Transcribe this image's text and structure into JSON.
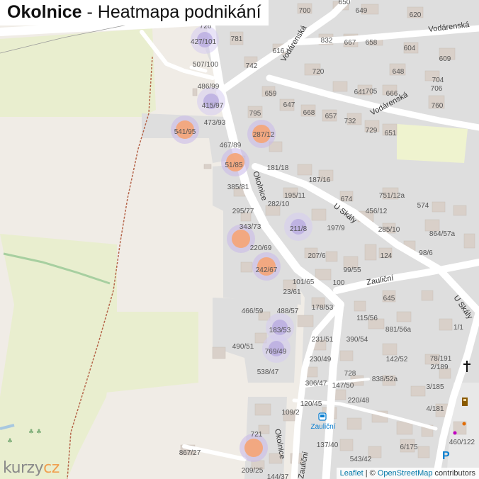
{
  "title": {
    "bold": "Okolnice",
    "rest": " - Heatmapa podnikání"
  },
  "logo": {
    "left": "kurzy",
    "right": "cz"
  },
  "attribution": {
    "leaflet": "Leaflet",
    "separator": " | © ",
    "osm": "OpenStreetMap",
    "suffix": " contributors"
  },
  "streets": [
    "Okolnice",
    "Vodárenská",
    "Vodárenská",
    "Vodárenská",
    "U Skály",
    "U Skály",
    "Zauliční",
    "Zauliční",
    "Okolnice"
  ],
  "bus_stop": "Zauliční",
  "address_labels": [
    "700",
    "650",
    "649",
    "620",
    "726",
    "781",
    "832",
    "667",
    "658",
    "604",
    "609",
    "427/101",
    "616",
    "742",
    "720",
    "648",
    "704",
    "706",
    "507/100",
    "705",
    "641",
    "666",
    "760",
    "486/99",
    "659",
    "647",
    "668",
    "657",
    "732",
    "729",
    "651",
    "415/97",
    "795",
    "473/93",
    "541/95",
    "287/12",
    "467/89",
    "51/85",
    "181/18",
    "187/16",
    "385/81",
    "195/11",
    "674",
    "751/12a",
    "282/10",
    "456/12",
    "574",
    "295/77",
    "343/73",
    "211/8",
    "197/9",
    "285/10",
    "864/57a",
    "220/69",
    "207/6",
    "124",
    "98/6",
    "242/67",
    "99/55",
    "101/65",
    "100",
    "23/61",
    "645",
    "466/59",
    "488/57",
    "178/53",
    "115/56",
    "1/1",
    "881/56a",
    "183/53",
    "231/51",
    "390/54",
    "490/51",
    "769/49",
    "230/49",
    "142/52",
    "78/191",
    "2/189",
    "538/47",
    "728",
    "838/52a",
    "306/47",
    "147/50",
    "3/185",
    "220/48",
    "109/2",
    "120/45",
    "4/181",
    "721",
    "137/40",
    "6/175",
    "460/122",
    "867/27",
    "543/42",
    "209/25",
    "144/37"
  ],
  "heat_spots": [
    {
      "kind": "orange",
      "label": "541/95"
    },
    {
      "kind": "orange",
      "label": "287/12"
    },
    {
      "kind": "orange",
      "label": "51/85"
    },
    {
      "kind": "orange",
      "label": "343/73"
    },
    {
      "kind": "orange",
      "label": "242/67"
    },
    {
      "kind": "orange",
      "label": "721"
    },
    {
      "kind": "purple",
      "label": "427/101"
    },
    {
      "kind": "purple",
      "label": "415/97"
    },
    {
      "kind": "purple",
      "label": "211/8"
    },
    {
      "kind": "purple",
      "label": "183/53"
    },
    {
      "kind": "purple",
      "label": "769/49"
    }
  ],
  "colors": {
    "background": "#f0ece6",
    "road": "#ffffff",
    "landuse": "#dcdcdc",
    "field": "#edf1d8",
    "building": "#d9d0c9",
    "heat_orange": "#f3a77b",
    "heat_purple": "#b4a5e0"
  }
}
